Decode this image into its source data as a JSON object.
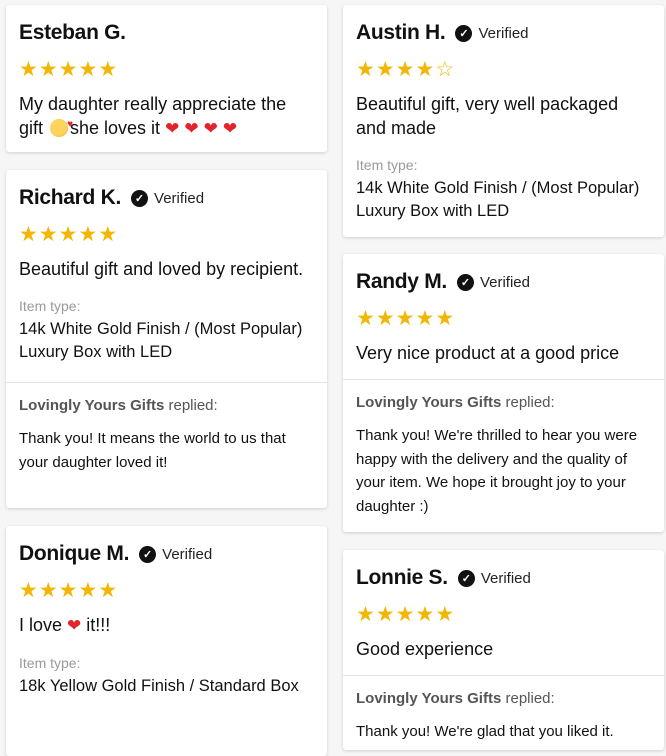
{
  "star_color": "#f2b705",
  "heart_color": "#e2252c",
  "verified_label": "Verified",
  "item_type_label": "Item type:",
  "replied_suffix": "replied:",
  "reviews": [
    {
      "name": "Esteban G.",
      "rating": 5,
      "text_parts": [
        "My daughter really appreciate the gift ",
        "she loves it "
      ]
    },
    {
      "name": "Richard K.",
      "rating": 5,
      "text": "Beautiful gift and loved by recipient.",
      "item_type": "14k White Gold Finish / (Most Popular) Luxury Box with LED",
      "reply_from": "Lovingly Yours Gifts",
      "reply_text": "Thank you! It means the world to us that your daughter loved it!"
    },
    {
      "name": "Donique M.",
      "rating": 5,
      "text_parts": [
        "I love ",
        " it!!!"
      ],
      "item_type": "18k Yellow Gold Finish / Standard Box"
    },
    {
      "name": "Austin H.",
      "rating": 4,
      "text": "Beautiful gift, very well packaged and made",
      "item_type": "14k White Gold Finish / (Most Popular) Luxury Box with LED"
    },
    {
      "name": "Randy M.",
      "rating": 5,
      "text": "Very nice product at a good price",
      "reply_from": "Lovingly Yours Gifts",
      "reply_text": "Thank you! We're thrilled to hear you were happy with the delivery and the quality of your item. We hope it brought joy to your daughter :)"
    },
    {
      "name": "Lonnie S.",
      "rating": 5,
      "text": "Good experience",
      "reply_from": "Lovingly Yours Gifts",
      "reply_text": "Thank you! We're glad that you liked it."
    }
  ]
}
